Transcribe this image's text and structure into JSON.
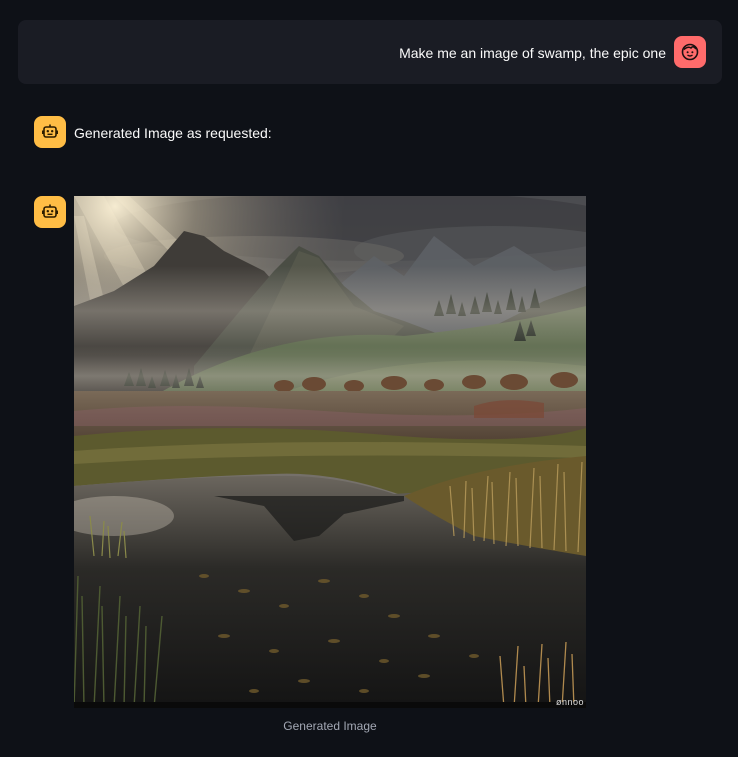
{
  "user_message": {
    "text": "Make me an image of swamp, the epic one",
    "avatar_icon": "user-face-icon",
    "avatar_color": "#ff6b6b"
  },
  "assistant_messages": [
    {
      "text": "Generated Image as requested:",
      "avatar_icon": "robot-icon",
      "avatar_color": "#ffbd45"
    },
    {
      "image": {
        "description_icon": "generated-landscape-image",
        "watermark": "ønnoo",
        "caption": "Generated Image"
      },
      "avatar_icon": "robot-icon",
      "avatar_color": "#ffbd45"
    }
  ],
  "colors": {
    "background": "#0e1117",
    "user_bubble": "#1a1c24",
    "caption_text": "#a3a8b4"
  }
}
